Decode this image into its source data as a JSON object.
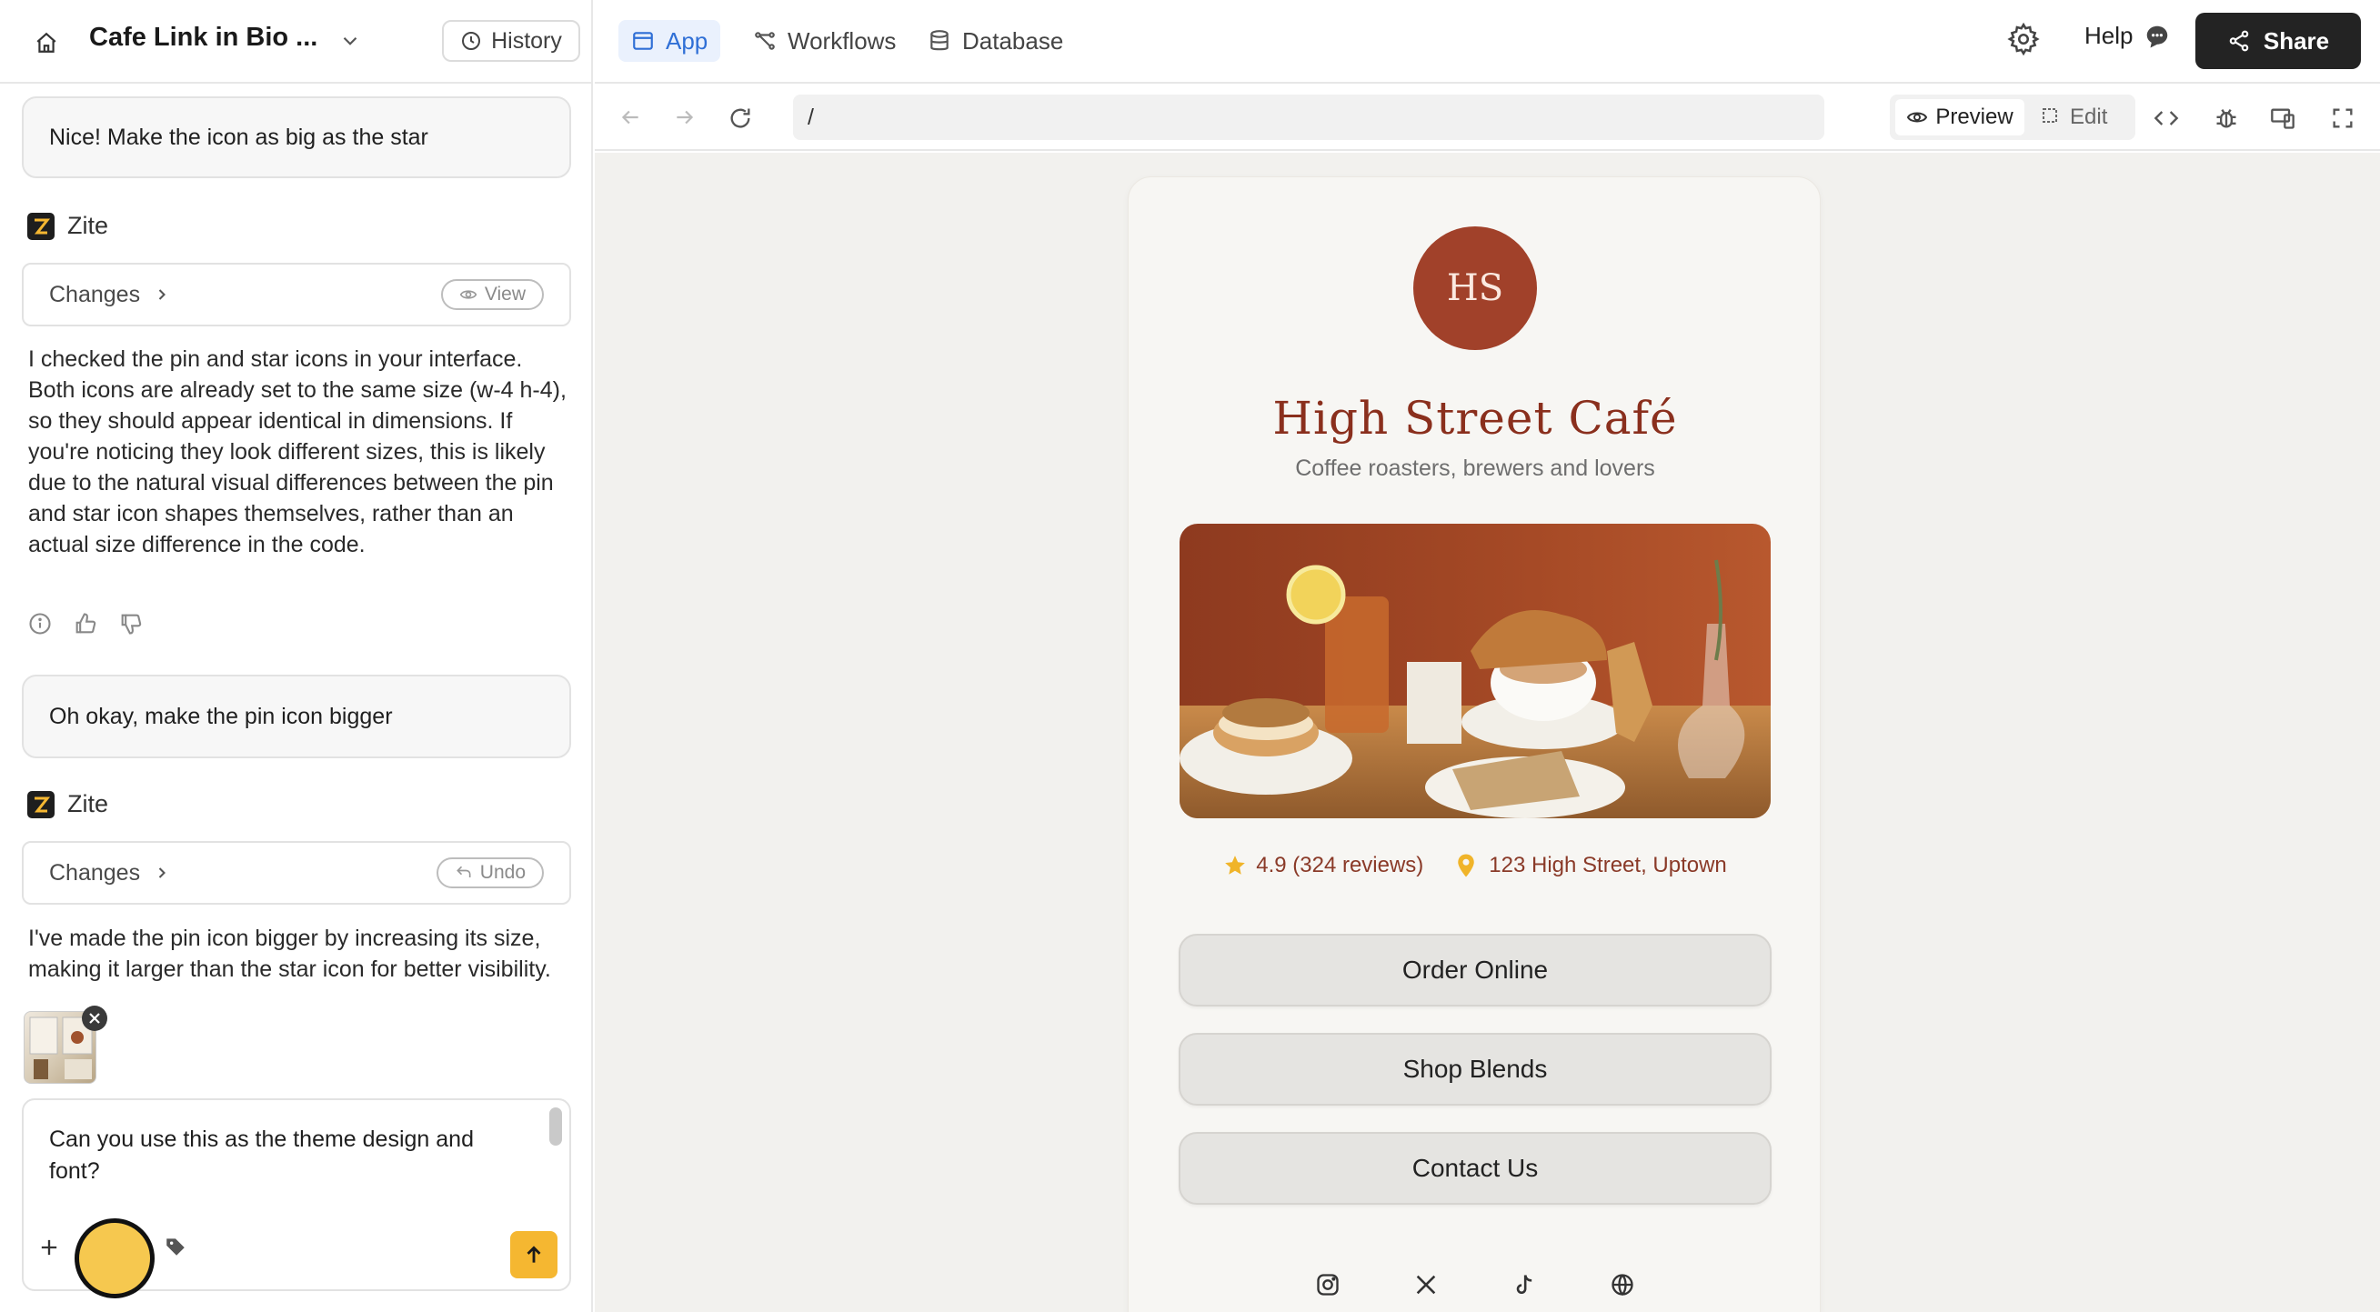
{
  "project": {
    "title": "Cafe Link in Bio ...",
    "history_label": "History"
  },
  "chat": {
    "user_msg_1": "Nice! Make the icon as big as the star",
    "assistant_name": "Zite",
    "changes_label": "Changes",
    "view_label": "View",
    "assistant_msg_1": "I checked the pin and star icons in your interface. Both icons are already set to the same size (w-4 h-4), so they should appear identical in dimensions. If you're noticing they look different sizes, this is likely due to the natural visual differences between the pin and star icon shapes themselves, rather than an actual size difference in the code.",
    "user_msg_2": "Oh okay, make the pin icon bigger",
    "undo_label": "Undo",
    "assistant_msg_2": "I've made the pin icon bigger by increasing its size, making it larger than the star icon for better visibility.",
    "composer_text": "Can you use this as the theme design and font?"
  },
  "topbar": {
    "tabs": [
      {
        "label": "App",
        "icon": "layout-icon",
        "active": true
      },
      {
        "label": "Workflows",
        "icon": "workflow-icon",
        "active": false
      },
      {
        "label": "Database",
        "icon": "database-icon",
        "active": false
      }
    ],
    "help_label": "Help",
    "share_label": "Share"
  },
  "browser": {
    "url": "/",
    "preview_label": "Preview",
    "edit_label": "Edit"
  },
  "app": {
    "avatar_initials": "HS",
    "name": "High Street Café",
    "tagline": "Coffee roasters, brewers and lovers",
    "rating": "4.9 (324 reviews)",
    "address": "123 High Street, Uptown",
    "buttons": [
      "Order Online",
      "Shop Blends",
      "Contact Us"
    ],
    "socials": [
      "instagram-icon",
      "x-icon",
      "tiktok-icon",
      "globe-icon"
    ]
  },
  "colors": {
    "accent_blue": "#2f6fd6",
    "brand_rust": "#a1412a",
    "brand_text": "#8a2f1d",
    "send_yellow": "#f5b731",
    "share_dark": "#232323"
  }
}
